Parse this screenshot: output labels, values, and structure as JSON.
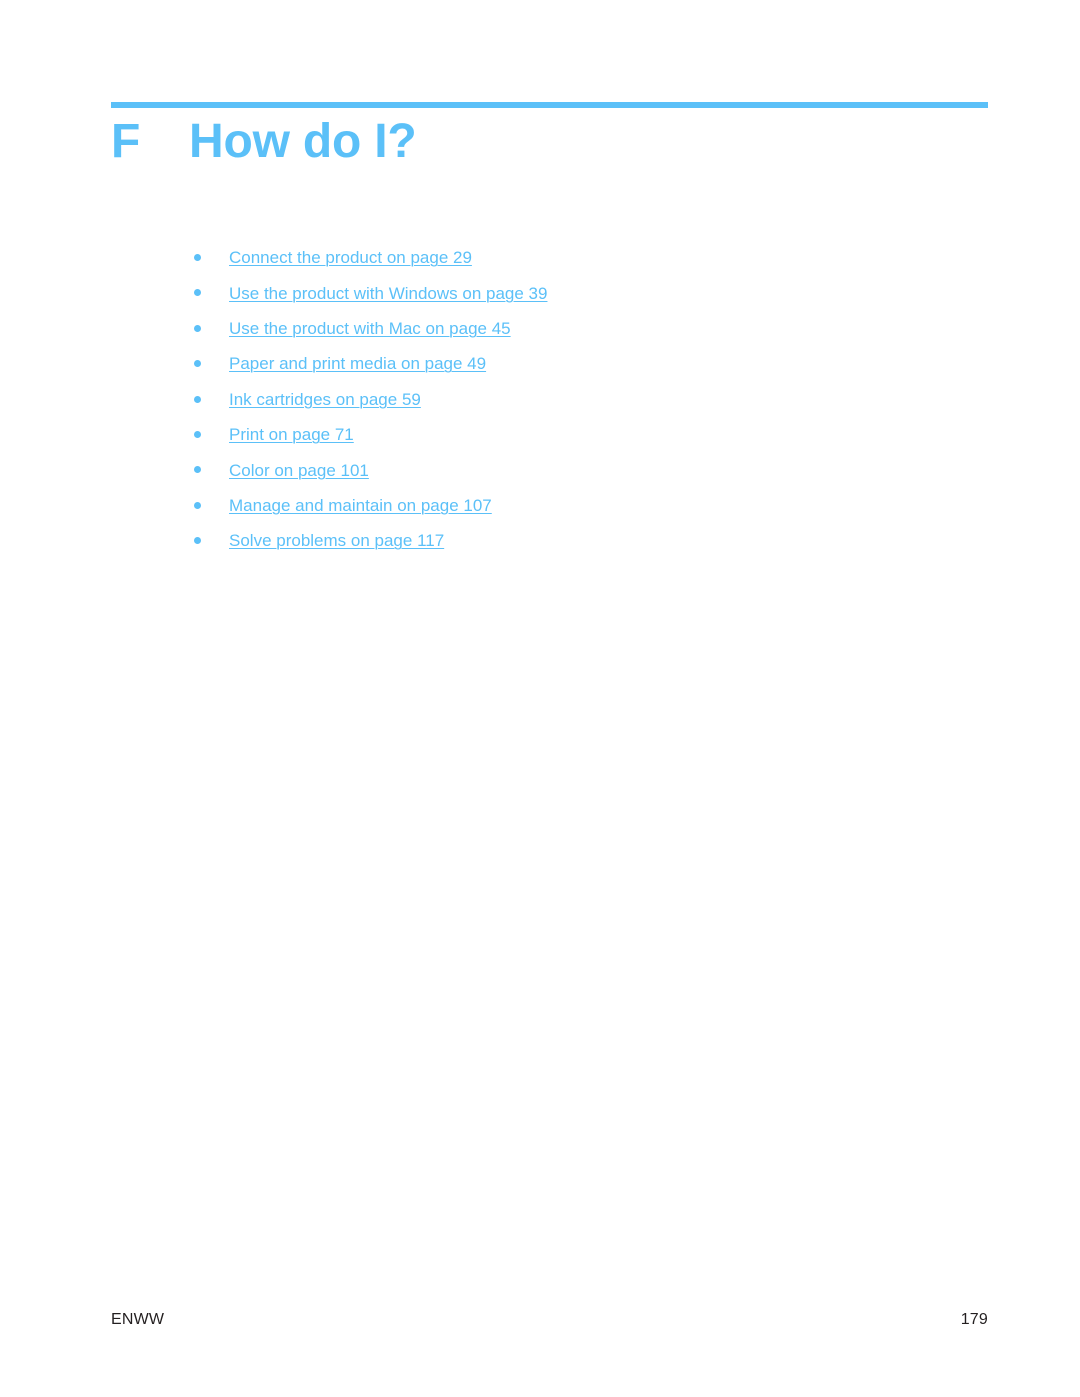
{
  "document": {
    "heading": {
      "number": "F",
      "title": "How do I?"
    },
    "accent_color": "#5BC0F8",
    "text_color": "#231F20",
    "background_color": "#FFFFFF"
  },
  "cross_reference_list": {
    "bullet_glyph": "•",
    "items": [
      {
        "label": "Connect the product on page 29"
      },
      {
        "label": "Use the product with Windows on page 39"
      },
      {
        "label": "Use the product with Mac on page 45"
      },
      {
        "label": "Paper and print media on page 49"
      },
      {
        "label": "Ink cartridges on page 59"
      },
      {
        "label": "Print on page 71"
      },
      {
        "label": "Color on page 101"
      },
      {
        "label": "Manage and maintain on page 107"
      },
      {
        "label": "Solve problems on page 117"
      }
    ]
  },
  "footer": {
    "locale": "ENWW",
    "page_number": "179"
  }
}
